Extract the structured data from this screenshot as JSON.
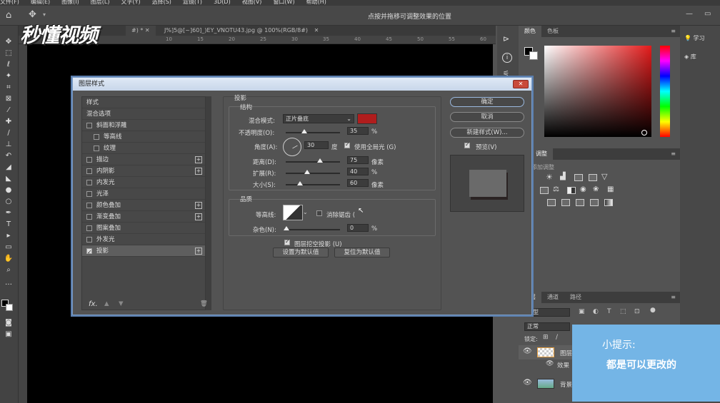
{
  "menubar": [
    "文件(F)",
    "编辑(E)",
    "图像(I)",
    "图层(L)",
    "文字(Y)",
    "选择(S)",
    "滤镜(T)",
    "3D(D)",
    "视图(V)",
    "窗口(W)",
    "帮助(H)"
  ],
  "options_hint": "点按并拖移可调整效果的位置",
  "doc_tab1": "#) *",
  "doc_tab2": "J%]5@[~]60]_)EY_VNOTU43.jpg @ 100%(RGB/8#)",
  "logo": "秒懂视频",
  "ruler": [
    "10",
    "15",
    "20",
    "25",
    "30",
    "35",
    "40",
    "45",
    "50",
    "55",
    "60",
    "65",
    "70",
    "75",
    "80",
    "85"
  ],
  "dialog": {
    "title": "图层样式",
    "close": "✕",
    "list": [
      {
        "label": "样式",
        "check": null,
        "indent": 0,
        "plus": false
      },
      {
        "label": "混合选项",
        "check": null,
        "indent": 0,
        "plus": false
      },
      {
        "label": "斜面和浮雕",
        "check": false,
        "indent": 0,
        "plus": false
      },
      {
        "label": "等高线",
        "check": false,
        "indent": 1,
        "plus": false
      },
      {
        "label": "纹理",
        "check": false,
        "indent": 1,
        "plus": false
      },
      {
        "label": "描边",
        "check": false,
        "indent": 0,
        "plus": true
      },
      {
        "label": "内阴影",
        "check": false,
        "indent": 0,
        "plus": true
      },
      {
        "label": "内发光",
        "check": false,
        "indent": 0,
        "plus": false
      },
      {
        "label": "光泽",
        "check": false,
        "indent": 0,
        "plus": false
      },
      {
        "label": "颜色叠加",
        "check": false,
        "indent": 0,
        "plus": true
      },
      {
        "label": "渐变叠加",
        "check": false,
        "indent": 0,
        "plus": true
      },
      {
        "label": "图案叠加",
        "check": false,
        "indent": 0,
        "plus": false
      },
      {
        "label": "外发光",
        "check": false,
        "indent": 0,
        "plus": false
      },
      {
        "label": "投影",
        "check": true,
        "indent": 0,
        "plus": true,
        "selected": true
      }
    ],
    "fx": "fx.",
    "section": "投影",
    "structure": "结构",
    "blend_label": "混合模式:",
    "blend_value": "正片叠底",
    "shadow_color": "#b01d1d",
    "opacity_label": "不透明度(O):",
    "opacity": "35",
    "pct": "%",
    "angle_label": "角度(A):",
    "angle": "30",
    "deg": "度",
    "global_light": "使用全局光 (G)",
    "distance_label": "距离(D):",
    "distance": "75",
    "px": "像素",
    "spread_label": "扩展(R):",
    "spread": "40",
    "size_label": "大小(S):",
    "size": "60",
    "quality": "品质",
    "contour_label": "等高线:",
    "antialias": "消除锯齿 (",
    "noise_label": "杂色(N):",
    "noise": "0",
    "knockout": "图层挖空投影 (U)",
    "set_default": "设置为默认值",
    "reset_default": "复位为默认值",
    "ok": "确定",
    "cancel": "取消",
    "new_style": "新建样式(W)...",
    "preview": "预览(V)"
  },
  "panels": {
    "color_tab": "颜色",
    "swatch_tab": "色板",
    "learn": "学习",
    "lib": "库",
    "adjust_tab": "调整",
    "adjust_title": "添加调整",
    "layers_tab": "图层",
    "channels_tab": "通道",
    "paths_tab": "路径",
    "kind": "类型",
    "normal": "正常",
    "lock": "锁定:",
    "layer1": "图层",
    "effect": "效果",
    "bg": "背景"
  },
  "hint": {
    "title": "小提示:",
    "body": "都是可以更改的"
  }
}
